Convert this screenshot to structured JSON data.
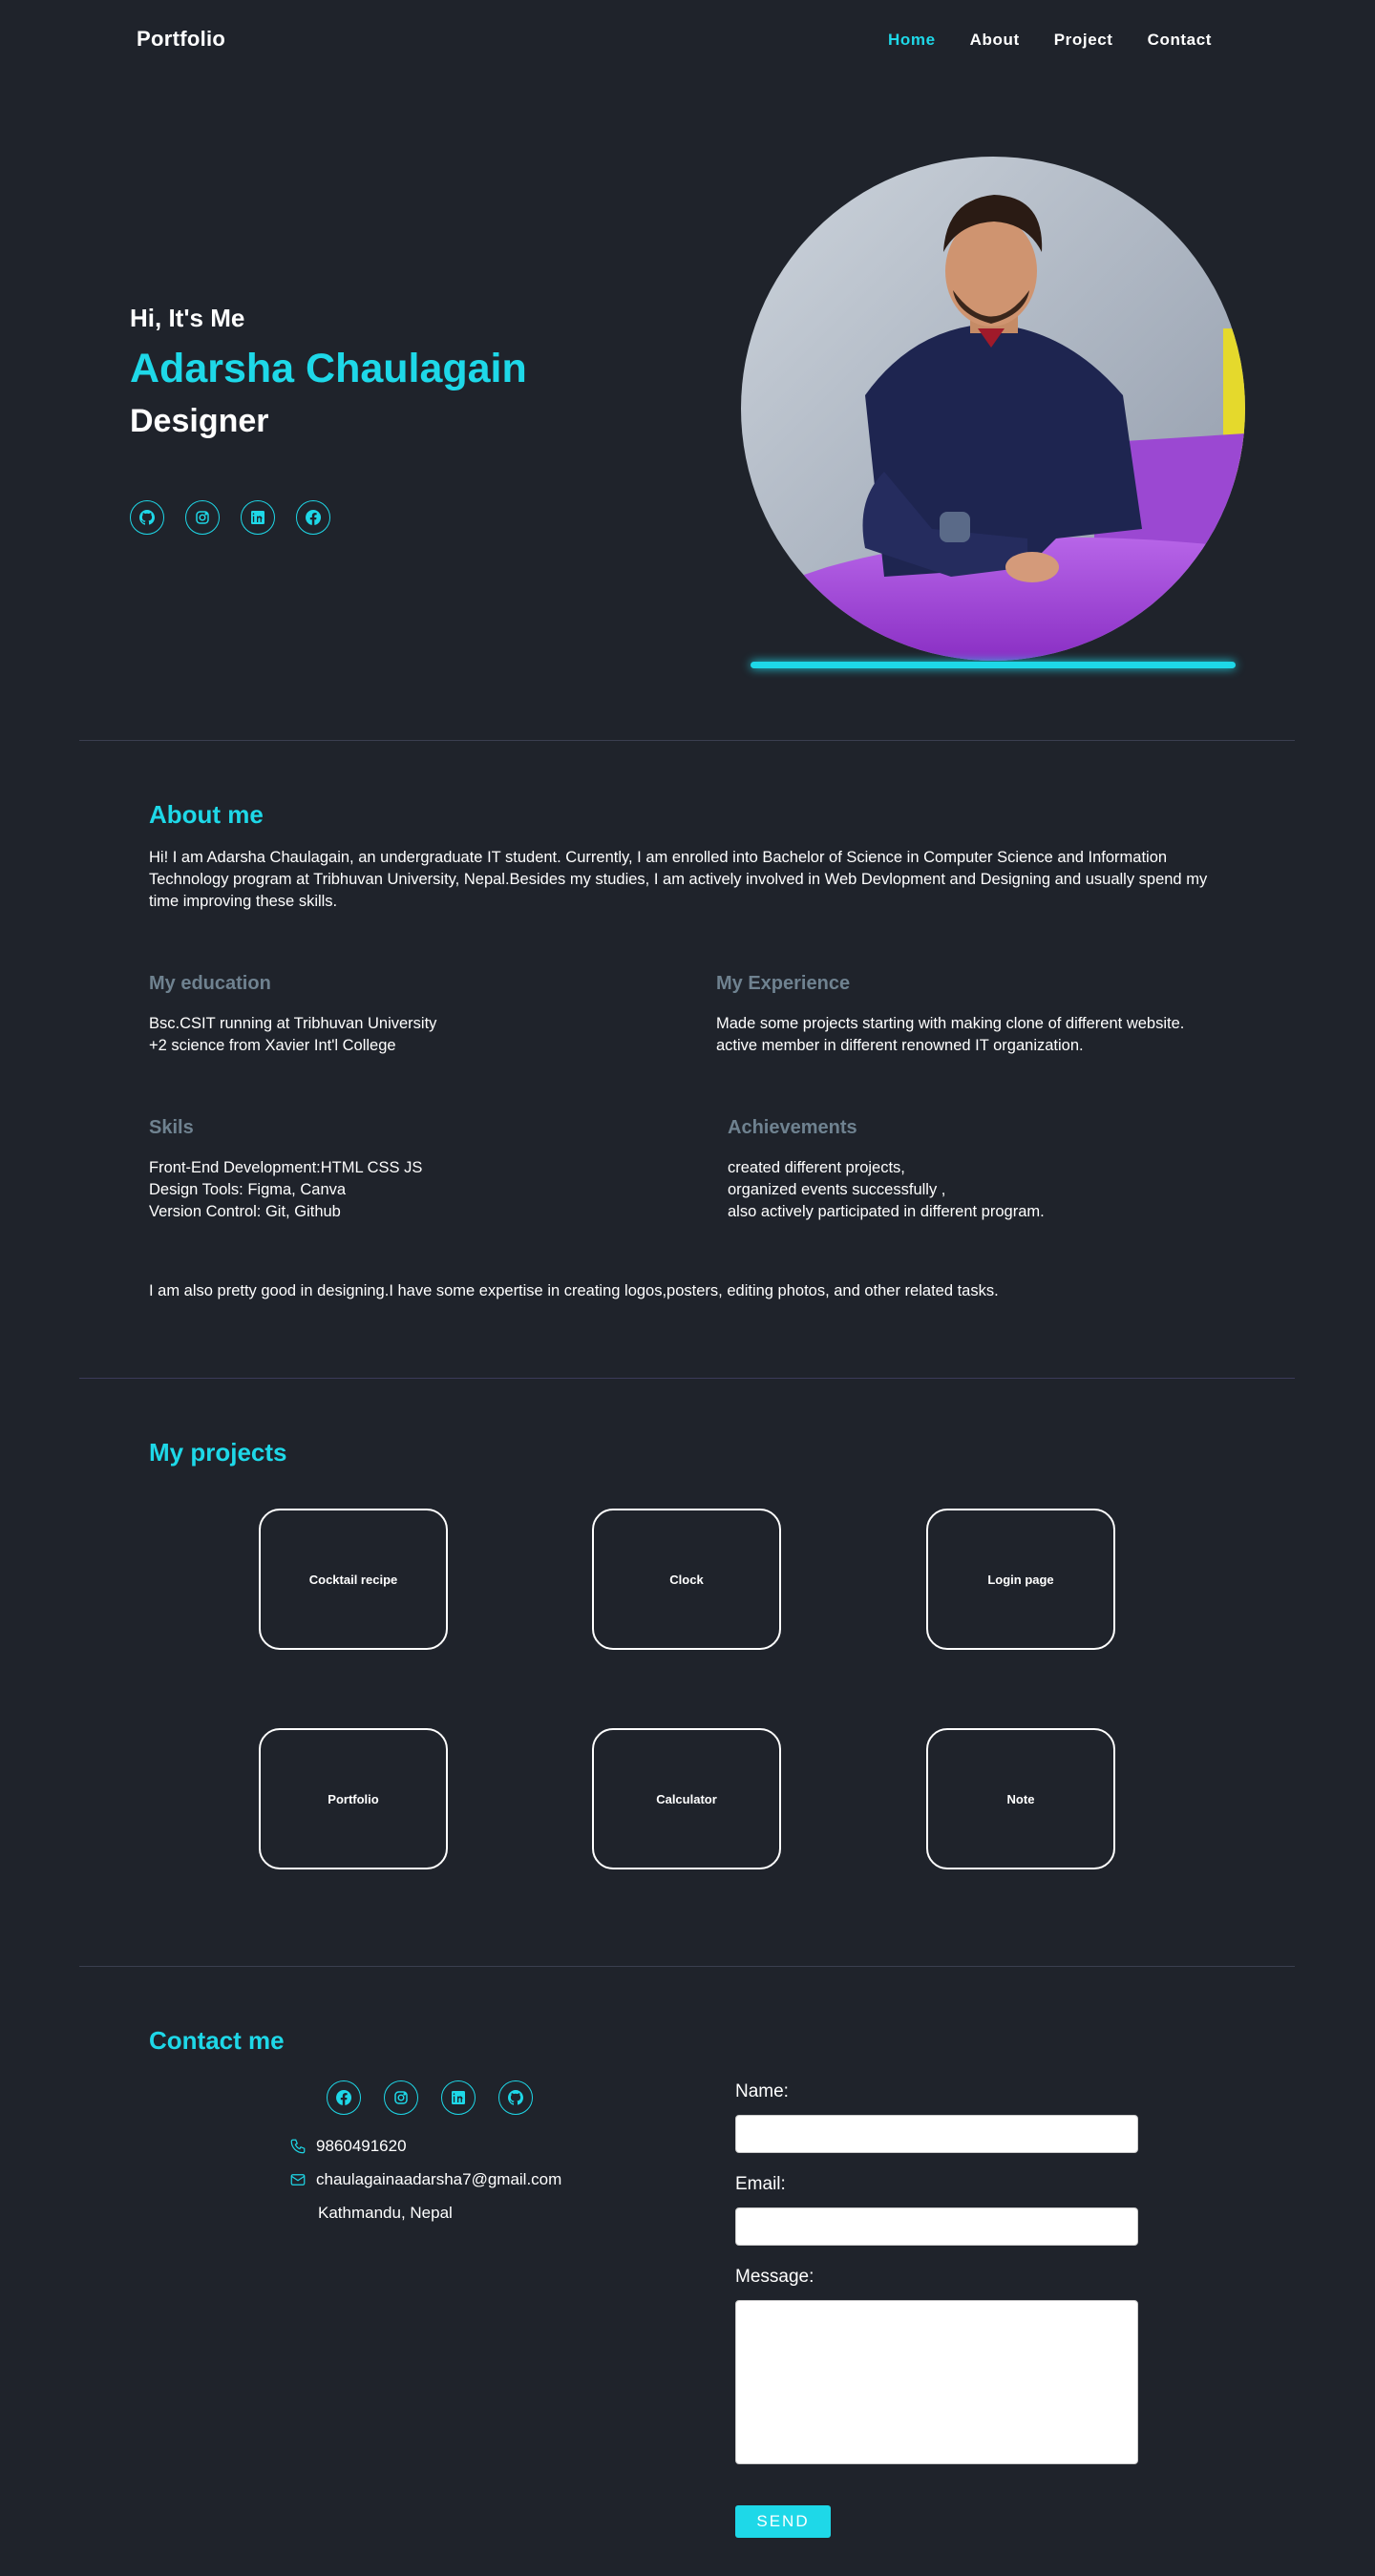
{
  "nav": {
    "brand": "Portfolio",
    "links": [
      "Home",
      "About",
      "Project",
      "Contact"
    ],
    "active": "Home"
  },
  "hero": {
    "greeting": "Hi, It's Me",
    "name": "Adarsha Chaulagain",
    "role": "Designer",
    "social_icons": [
      "github-icon",
      "instagram-icon",
      "linkedin-icon",
      "facebook-icon"
    ]
  },
  "about": {
    "title": "About me",
    "intro": "Hi! I am Adarsha Chaulagain, an undergraduate IT student. Currently, I am enrolled into Bachelor of Science in Computer Science and Information Technology program at Tribhuvan University, Nepal.Besides my studies, I am actively involved in Web Devlopment and Designing and usually spend my time improving these skills.",
    "education_title": "My education",
    "education": [
      "Bsc.CSIT running at Tribhuvan University",
      "+2 science from Xavier Int'l College"
    ],
    "experience_title": "My Experience",
    "experience": [
      "Made some projects starting with making clone of different website.",
      "active member in different renowned IT organization."
    ],
    "skills_title": "Skils",
    "skills": [
      "Front-End Development:HTML CSS JS",
      "Design Tools: Figma, Canva",
      "Version Control: Git, Github"
    ],
    "achievements_title": "Achievements",
    "achievements": [
      "created different projects,",
      "organized events successfully ,",
      "also actively participated in different program."
    ],
    "outro": "I am also pretty good in designing.I have some expertise in creating logos,posters, editing photos, and other related tasks."
  },
  "projects": {
    "title": "My projects",
    "items": [
      "Cocktail recipe",
      "Clock",
      "Login page",
      "Portfolio",
      "Calculator",
      "Note"
    ]
  },
  "contact": {
    "title": "Contact me",
    "social_icons": [
      "facebook-icon",
      "instagram-icon",
      "linkedin-icon",
      "github-icon"
    ],
    "phone": "9860491620",
    "email": "chaulagainaadarsha7@gmail.com",
    "location": "Kathmandu, Nepal",
    "form": {
      "name_label": "Name:",
      "email_label": "Email:",
      "message_label": "Message:",
      "send_label": "SEND"
    }
  },
  "colors": {
    "accent": "#1ed8e8",
    "background": "#1f232b",
    "muted_heading": "#6f8290"
  }
}
